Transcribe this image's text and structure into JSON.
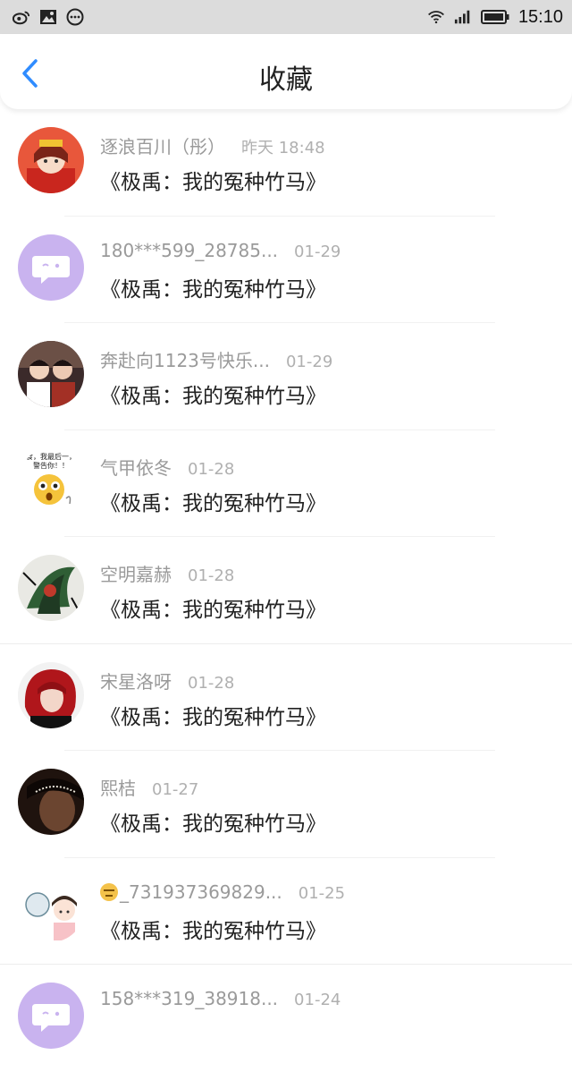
{
  "status": {
    "time": "15:10"
  },
  "header": {
    "title": "收藏"
  },
  "items": [
    {
      "name": "逐浪百川（彤）",
      "time": "昨天 18:48",
      "book": "《极禹：我的冤种竹马》"
    },
    {
      "name": "180***599_28785...",
      "time": "01-29",
      "book": "《极禹：我的冤种竹马》"
    },
    {
      "name": "奔赴向1123号快乐...",
      "time": "01-29",
      "book": "《极禹：我的冤种竹马》"
    },
    {
      "name": "气甲依冬",
      "time": "01-28",
      "book": "《极禹：我的冤种竹马》",
      "avatar_text": "食，我最后一，警告你！！"
    },
    {
      "name": "空明嘉赫",
      "time": "01-28",
      "book": "《极禹：我的冤种竹马》"
    },
    {
      "name": "宋星洛呀",
      "time": "01-28",
      "book": "《极禹：我的冤种竹马》"
    },
    {
      "name": "熙桔",
      "time": "01-27",
      "book": "《极禹：我的冤种竹马》"
    },
    {
      "name": "_731937369829...",
      "time": "01-25",
      "book": "《极禹：我的冤种竹马》"
    },
    {
      "name": "158***319_38918...",
      "time": "01-24",
      "book": ""
    }
  ],
  "colors": {
    "accent": "#2f8cff",
    "default_avatar": "#c9b3ef"
  },
  "icons": [
    "weibo-icon",
    "image-icon",
    "more-icon",
    "wifi-icon",
    "signal-icon",
    "battery-icon",
    "back-arrow-icon"
  ]
}
